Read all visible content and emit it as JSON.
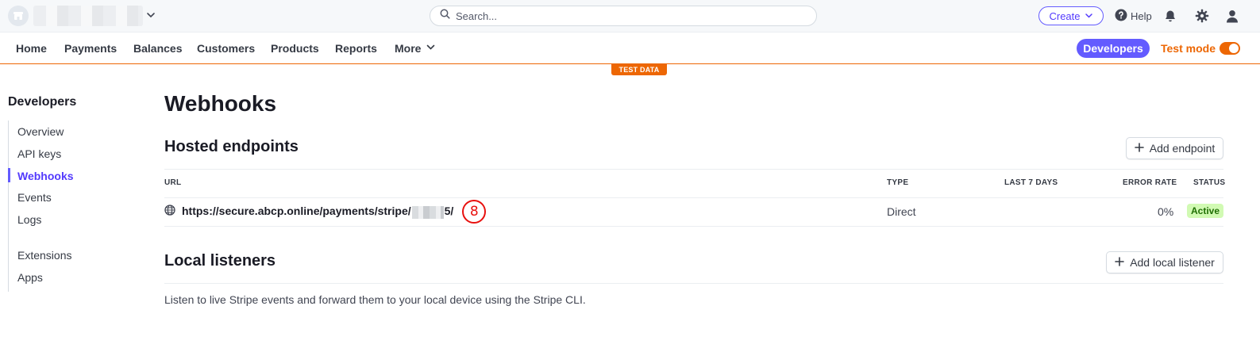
{
  "header": {
    "search_placeholder": "Search...",
    "create_label": "Create",
    "help_label": "Help"
  },
  "nav": {
    "items": [
      "Home",
      "Payments",
      "Balances",
      "Customers",
      "Products",
      "Reports"
    ],
    "more_label": "More",
    "developers_label": "Developers",
    "test_mode_label": "Test mode",
    "test_mode_on": true,
    "test_data_banner": "TEST DATA"
  },
  "sidebar": {
    "title": "Developers",
    "items": [
      "Overview",
      "API keys",
      "Webhooks",
      "Events",
      "Logs"
    ],
    "active_item": "Webhooks",
    "items_secondary": [
      "Extensions",
      "Apps"
    ]
  },
  "main": {
    "title": "Webhooks",
    "hosted": {
      "heading": "Hosted endpoints",
      "add_button": "Add endpoint",
      "columns": [
        "URL",
        "TYPE",
        "LAST 7 DAYS",
        "ERROR RATE",
        "STATUS"
      ],
      "rows": [
        {
          "url_prefix": "https://secure.abcp.online/payments/stripe/",
          "url_suffix": "5/",
          "marker": "8",
          "type": "Direct",
          "last_7_days": "",
          "error_rate": "0%",
          "status": "Active"
        }
      ]
    },
    "local": {
      "heading": "Local listeners",
      "add_button": "Add local listener",
      "description": "Listen to live Stripe events and forward them to your local device using the Stripe CLI."
    }
  },
  "colors": {
    "accent": "#635bff",
    "test_mode": "#ed6704",
    "active_badge_bg": "#d1fab3",
    "active_badge_text": "#217005",
    "marker_red": "#e8110f"
  }
}
